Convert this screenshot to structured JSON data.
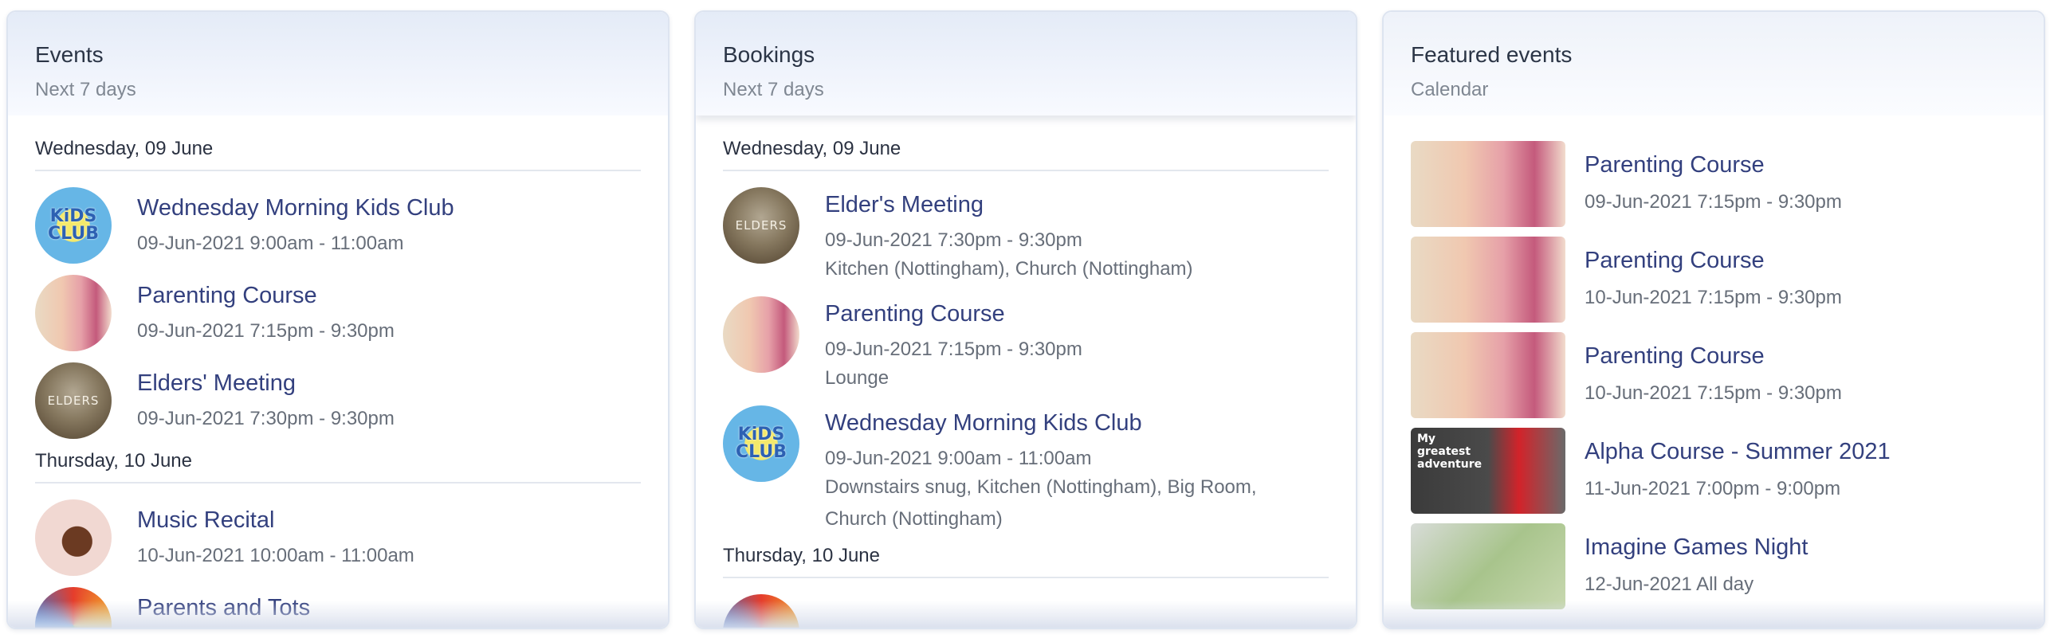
{
  "events_panel": {
    "title": "Events",
    "subtitle": "Next 7 days",
    "days": [
      {
        "label": "Wednesday, 09 June",
        "items": [
          {
            "title": "Wednesday Morning Kids Club",
            "time": "09-Jun-2021 9:00am - 11:00am",
            "icon": "kids-club"
          },
          {
            "title": "Parenting Course",
            "time": "09-Jun-2021 7:15pm - 9:30pm",
            "icon": "baby"
          },
          {
            "title": "Elders' Meeting",
            "time": "09-Jun-2021 7:30pm - 9:30pm",
            "icon": "elders"
          }
        ]
      },
      {
        "label": "Thursday, 10 June",
        "items": [
          {
            "title": "Music Recital",
            "time": "10-Jun-2021 10:00am - 11:00am",
            "icon": "violin"
          },
          {
            "title": "Parents and Tots",
            "time": "",
            "icon": "tots"
          }
        ]
      }
    ]
  },
  "bookings_panel": {
    "title": "Bookings",
    "subtitle": "Next 7 days",
    "days": [
      {
        "label": "Wednesday, 09 June",
        "items": [
          {
            "title": "Elder's Meeting",
            "time": "09-Jun-2021 7:30pm - 9:30pm",
            "location": "Kitchen (Nottingham), Church (Nottingham)",
            "icon": "elders"
          },
          {
            "title": "Parenting Course",
            "time": "09-Jun-2021 7:15pm - 9:30pm",
            "location": "Lounge",
            "icon": "baby"
          },
          {
            "title": "Wednesday Morning Kids Club",
            "time": "09-Jun-2021 9:00am - 11:00am",
            "location": "Downstairs snug, Kitchen (Nottingham), Big Room, Church (Nottingham)",
            "icon": "kids-club"
          }
        ]
      },
      {
        "label": "Thursday, 10 June",
        "items": []
      }
    ]
  },
  "featured_panel": {
    "title": "Featured events",
    "subtitle": "Calendar",
    "items": [
      {
        "title": "Parenting Course",
        "time": "09-Jun-2021 7:15pm - 9:30pm",
        "icon": "baby"
      },
      {
        "title": "Parenting Course",
        "time": "10-Jun-2021 7:15pm - 9:30pm",
        "icon": "baby"
      },
      {
        "title": "Parenting Course",
        "time": "10-Jun-2021 7:15pm - 9:30pm",
        "icon": "baby"
      },
      {
        "title": "Alpha Course - Summer 2021",
        "time": "11-Jun-2021 7:00pm - 9:00pm",
        "icon": "alpha"
      },
      {
        "title": "Imagine Games Night",
        "time": "12-Jun-2021 All day",
        "icon": "games"
      }
    ]
  },
  "thumb_text": {
    "kids": "KiDS CLUB",
    "elders": "ELDERS",
    "alpha": "My greatest adventure"
  }
}
